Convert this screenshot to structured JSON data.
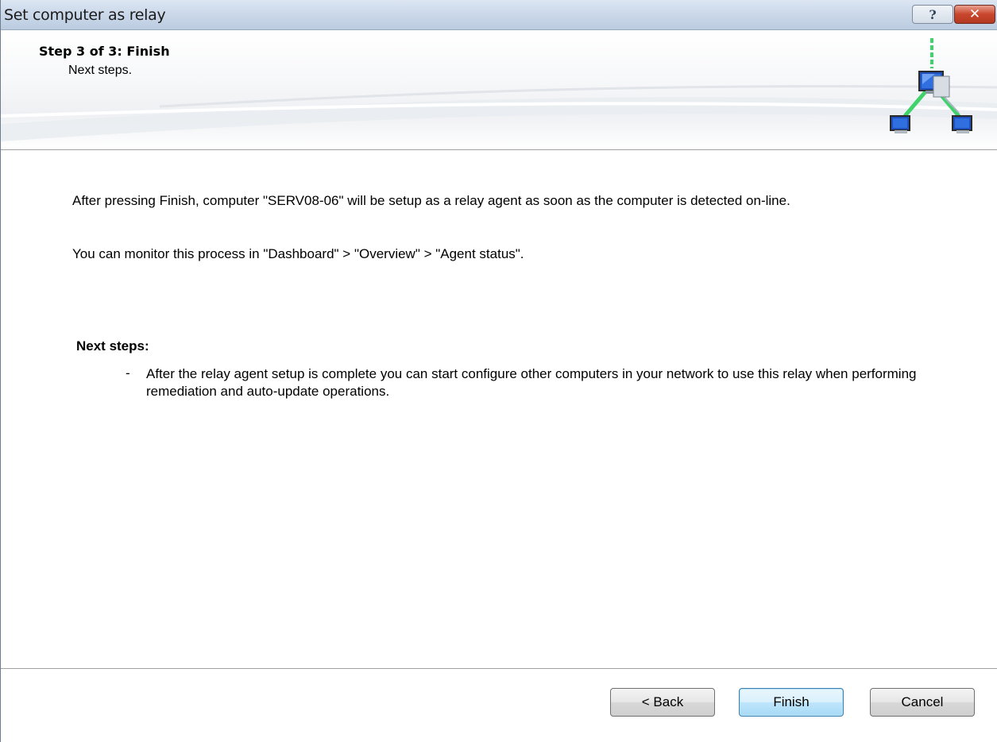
{
  "window": {
    "title": "Set computer as relay",
    "help_button": "?",
    "close_button": "✕"
  },
  "header": {
    "step_title": "Step 3 of 3: Finish",
    "step_subtitle": "Next steps.",
    "icon": "network-relay-icon"
  },
  "content": {
    "paragraph1": "After pressing Finish, computer \"SERV08-06\" will be setup as a relay agent as soon as the computer is detected on-line.",
    "paragraph2": "You can monitor this process in \"Dashboard\" > \"Overview\" > \"Agent status\".",
    "next_steps_heading": "Next steps:",
    "next_steps_bullet": "-",
    "next_steps_item": "After the relay agent setup is complete you can start configure other computers in your network to use this relay when performing remediation and auto-update operations."
  },
  "footer": {
    "back_label": "< Back",
    "finish_label": "Finish",
    "cancel_label": "Cancel"
  },
  "colors": {
    "titlebar": "#c8d6e8",
    "close_button": "#c9462c",
    "default_button_border": "#3c7fb1",
    "connector_green": "#3fd36a"
  }
}
